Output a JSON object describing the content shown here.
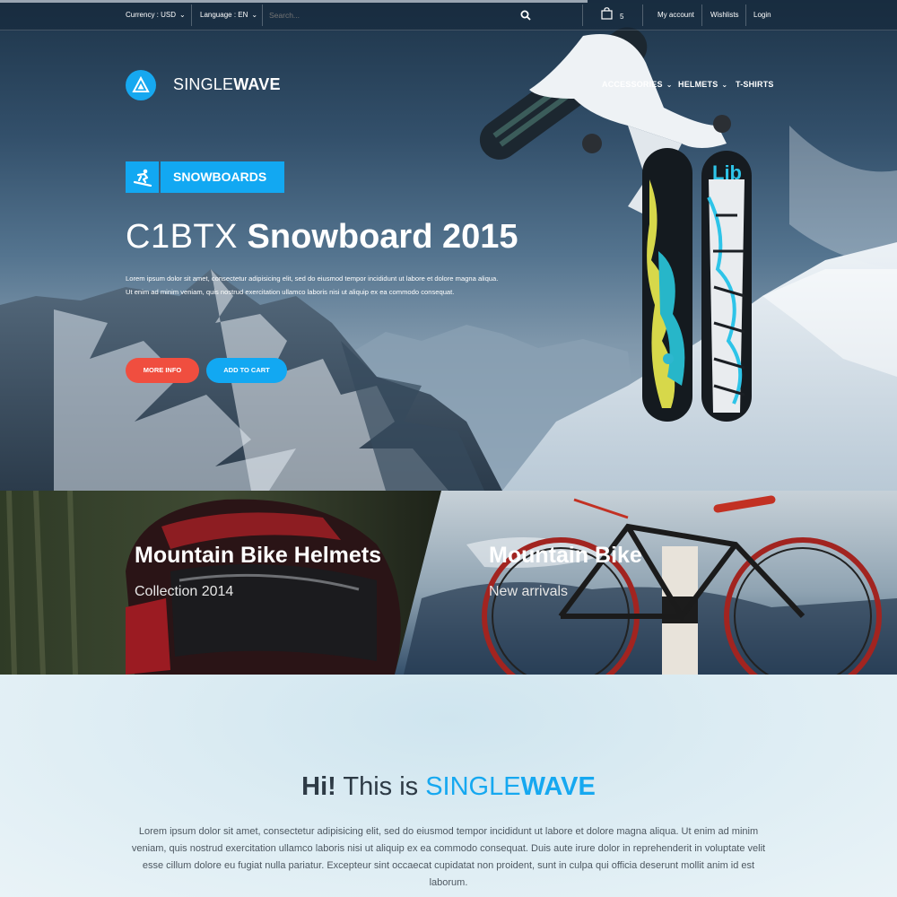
{
  "topbar": {
    "currency_label": "Currency : USD",
    "language_label": "Language : EN",
    "search_placeholder": "Search...",
    "cart_count": "5",
    "links": [
      "My account",
      "Wishlists",
      "Login"
    ]
  },
  "brand": {
    "name_light": "SINGLE",
    "name_bold": "WAVE",
    "logo_icon": "triangle-logo-icon"
  },
  "nav": {
    "items": [
      {
        "label": "ACCESSORIES",
        "has_dropdown": true
      },
      {
        "label": "HELMETS",
        "has_dropdown": true
      },
      {
        "label": "T-SHIRTS",
        "has_dropdown": false
      }
    ]
  },
  "hero": {
    "category_label": "SNOWBOARDS",
    "category_icon": "snowboarder-icon",
    "title_light": "C1BTX",
    "title_bold": "Snowboard 2015",
    "description": "Lorem ipsum dolor sit amet, consectetur adipisicing elit, sed do eiusmod tempor incididunt ut labore et dolore magna aliqua. Ut enim ad minim veniam, quis nostrud exercitation ullamco laboris nisi ut aliquip ex ea commodo consequat.",
    "more_info_label": "MORE INFO",
    "add_to_cart_label": "ADD TO CART"
  },
  "banners": [
    {
      "title": "Mountain Bike Helmets",
      "subtitle": "Collection 2014"
    },
    {
      "title": "Mountain Bike",
      "subtitle": "New arrivals"
    }
  ],
  "intro": {
    "hi": "Hi!",
    "text_mid": " This is ",
    "brand_light": "SINGLE",
    "brand_bold": "WAVE",
    "paragraph": "Lorem ipsum dolor sit amet, consectetur adipisicing elit, sed do eiusmod tempor incididunt ut labore et dolore magna aliqua. Ut enim ad minim veniam, quis nostrud exercitation ullamco laboris nisi ut aliquip ex ea commodo consequat. Duis aute irure dolor in reprehenderit in voluptate velit esse cillum dolore eu fugiat nulla pariatur. Excepteur sint occaecat cupidatat non proident, sunt in culpa qui officia deserunt mollit anim id est laborum."
  },
  "colors": {
    "accent": "#16a8f0",
    "more_info": "#f04e3f",
    "dark_text": "#2d3a45"
  }
}
